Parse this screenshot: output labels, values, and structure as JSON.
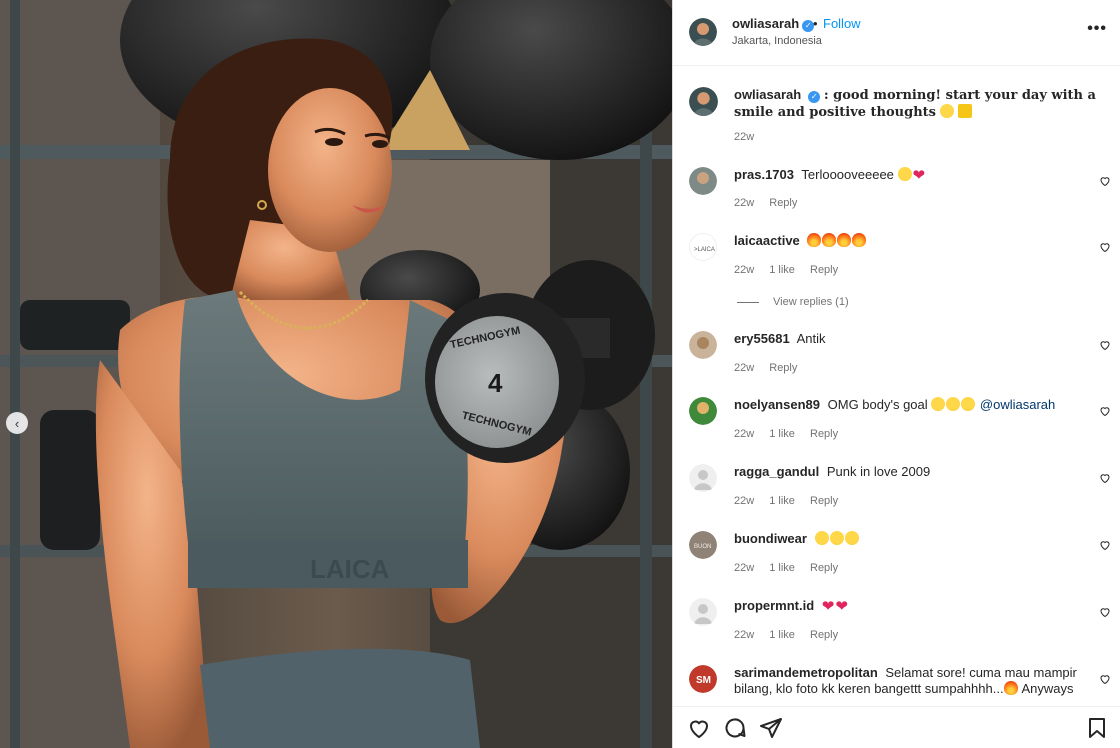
{
  "post": {
    "username": "owliasarah",
    "verified": true,
    "follow_label": "Follow",
    "separator": "•",
    "location": "Jakarta, Indonesia",
    "more_label": "•••"
  },
  "caption": {
    "username": "owliasarah",
    "text": ": good morning! start your day with a smile and positive thoughts",
    "emojis": [
      "smiling-face-with-hearts",
      "sparkles"
    ],
    "time": "22w"
  },
  "comments": [
    {
      "username": "pras.1703",
      "text": "Terlooooveeeee",
      "emojis": [
        "heart-eyes",
        "red-heart"
      ],
      "time": "22w",
      "likes": "",
      "reply": "Reply"
    },
    {
      "username": "laicaactive",
      "text": "",
      "emojis": [
        "fire",
        "fire",
        "fire",
        "fire"
      ],
      "time": "22w",
      "likes": "1 like",
      "reply": "Reply",
      "view_replies": "View replies (1)"
    },
    {
      "username": "ery55681",
      "text": "Antik",
      "emojis": [],
      "time": "22w",
      "likes": "",
      "reply": "Reply"
    },
    {
      "username": "noelyansen89",
      "text": "OMG body's goal",
      "emojis": [
        "heart-eyes",
        "heart-eyes",
        "heart-eyes"
      ],
      "mention": "@owliasarah",
      "time": "22w",
      "likes": "1 like",
      "reply": "Reply"
    },
    {
      "username": "ragga_gandul",
      "text": "Punk in love 2009",
      "emojis": [],
      "time": "22w",
      "likes": "1 like",
      "reply": "Reply"
    },
    {
      "username": "buondiwear",
      "text": "",
      "emojis": [
        "heart-eyes",
        "heart-eyes",
        "heart-eyes"
      ],
      "time": "22w",
      "likes": "1 like",
      "reply": "Reply"
    },
    {
      "username": "propermnt.id",
      "text": "",
      "emojis": [
        "red-heart",
        "red-heart"
      ],
      "time": "22w",
      "likes": "1 like",
      "reply": "Reply"
    },
    {
      "username": "sarimandemetropolitan",
      "text": "Selamat sore! cuma mau mampir bilang, klo foto kk keren bangettt sumpahhhh...",
      "text_tail": "Anyways",
      "emojis": [
        "fire"
      ]
    }
  ],
  "media": {
    "dumbbell_number": "4",
    "dumbbell_brand": "TECHNOGYM",
    "top_brand": "LAICA"
  },
  "icons": {
    "verified": "verified-badge-icon",
    "like": "heart-outline-icon",
    "comment": "comment-bubble-icon",
    "share": "paper-plane-icon",
    "save": "bookmark-icon",
    "prev": "chevron-left-icon",
    "more": "more-dots-icon"
  },
  "colors": {
    "link_blue": "#0095f6",
    "verified_blue": "#3897f0",
    "meta_gray": "#737373",
    "mention": "#00376b"
  }
}
